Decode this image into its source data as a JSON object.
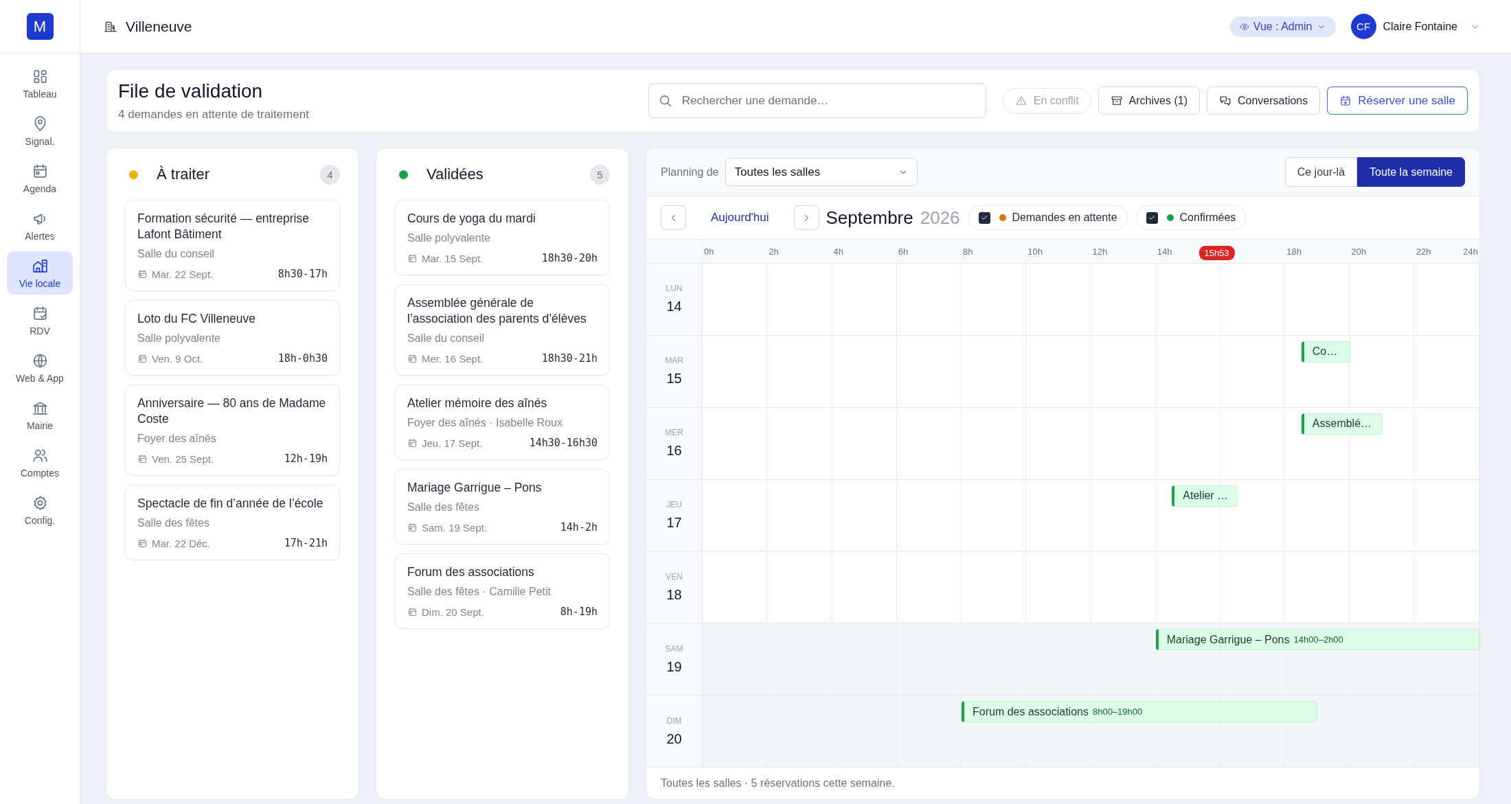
{
  "app": {
    "logo": "M"
  },
  "sidebar": {
    "items": [
      {
        "label": "Tableau",
        "selected": false
      },
      {
        "label": "Signal.",
        "selected": false
      },
      {
        "label": "Agenda",
        "selected": false
      },
      {
        "label": "Alertes",
        "selected": false
      },
      {
        "label": "Vie locale",
        "selected": true
      },
      {
        "label": "RDV",
        "selected": false
      },
      {
        "label": "Web & App",
        "selected": false
      },
      {
        "label": "Mairie",
        "selected": false
      },
      {
        "label": "Comptes",
        "selected": false
      },
      {
        "label": "Config.",
        "selected": false
      }
    ]
  },
  "header": {
    "location": "Villeneuve",
    "view_pill": "Vue : Admin",
    "user": {
      "initials": "CF",
      "name": "Claire Fontaine"
    }
  },
  "queue": {
    "title": "File de validation",
    "subtitle": "4 demandes en attente de traitement",
    "search": {
      "placeholder": "Rechercher une demande…"
    },
    "buttons": [
      {
        "label": "En conflit",
        "kind": "pill",
        "disabled": true
      },
      {
        "label": "Archives (1)",
        "kind": "outline",
        "disabled": false
      },
      {
        "label": "Conversations",
        "kind": "outline",
        "disabled": false
      },
      {
        "label": "Réserver une salle",
        "kind": "accent",
        "disabled": false
      }
    ]
  },
  "columns": [
    {
      "title": "À traiter",
      "color": "#eab308",
      "count": "4",
      "cards": [
        {
          "title": "Formation sécurité — entreprise Lafont Bâtiment",
          "place": "Salle du conseil",
          "date": "Mar. 22 Sept.",
          "time": "8h30-17h"
        },
        {
          "title": "Loto du FC Villeneuve",
          "place": "Salle polyvalente",
          "date": "Ven. 9 Oct.",
          "time": "18h-0h30"
        },
        {
          "title": "Anniversaire — 80 ans de Madame Coste",
          "place": "Foyer des aînés",
          "date": "Ven. 25 Sept.",
          "time": "12h-19h"
        },
        {
          "title": "Spectacle de fin d’année de l’école",
          "place": "Salle des fêtes",
          "date": "Mar. 22 Déc.",
          "time": "17h-21h"
        }
      ]
    },
    {
      "title": "Validées",
      "color": "#16a34a",
      "count": "5",
      "cards": [
        {
          "title": "Cours de yoga du mardi",
          "place": "Salle polyvalente",
          "date": "Mar. 15 Sept.",
          "time": "18h30-20h"
        },
        {
          "title": "Assemblée générale de l’association des parents d’élèves",
          "place": "Salle du conseil",
          "date": "Mer. 16 Sept.",
          "time": "18h30-21h"
        },
        {
          "title": "Atelier mémoire des aînés",
          "place": "Foyer des aînés · Isabelle Roux",
          "date": "Jeu. 17 Sept.",
          "time": "14h30-16h30"
        },
        {
          "title": "Mariage Garrigue – Pons",
          "place": "Salle des fêtes",
          "date": "Sam. 19 Sept.",
          "time": "14h-2h"
        },
        {
          "title": "Forum des associations",
          "place": "Salle des fêtes · Camille Petit",
          "date": "Dim. 20 Sept.",
          "time": "8h-19h"
        }
      ]
    }
  ],
  "planning": {
    "label": "Planning de",
    "room_select": "Toutes les salles",
    "range_tabs": [
      {
        "label": "Ce jour-là",
        "selected": false
      },
      {
        "label": "Toute la semaine",
        "selected": true
      }
    ],
    "today_button": "Aujourd'hui",
    "month": "Septembre",
    "year": "2026",
    "filters": [
      {
        "label": "Demandes en attente",
        "color": "#d97706",
        "checked": true
      },
      {
        "label": "Confirmées",
        "color": "#16a34a",
        "checked": true
      }
    ],
    "hours": [
      "0h",
      "2h",
      "4h",
      "6h",
      "8h",
      "10h",
      "12h",
      "14h",
      "18h",
      "20h",
      "22h",
      "24h"
    ],
    "now": "15h53",
    "days": [
      {
        "weekday": "LUN",
        "date": "14",
        "weekend": false
      },
      {
        "weekday": "MAR",
        "date": "15",
        "weekend": false,
        "events": [
          {
            "label": "Co…"
          }
        ]
      },
      {
        "weekday": "MER",
        "date": "16",
        "weekend": false,
        "events": [
          {
            "label": "Assemblé…"
          }
        ]
      },
      {
        "weekday": "JEU",
        "date": "17",
        "weekend": false,
        "events": [
          {
            "label": "Atelier …"
          }
        ]
      },
      {
        "weekday": "VEN",
        "date": "18",
        "weekend": false
      },
      {
        "weekday": "SAM",
        "date": "19",
        "weekend": true,
        "events": [
          {
            "label": "Mariage Garrigue – Pons",
            "time": "14h00–2h00"
          }
        ]
      },
      {
        "weekday": "DIM",
        "date": "20",
        "weekend": true,
        "events": [
          {
            "label": "Forum des associations",
            "time": "8h00–19h00"
          }
        ]
      }
    ],
    "footer": "Toutes les salles · 5 réservations cette semaine."
  }
}
